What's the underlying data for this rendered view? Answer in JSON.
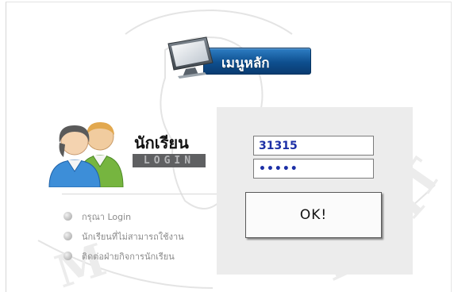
{
  "menu": {
    "label": "เมนูหลัก"
  },
  "login_card": {
    "title": "นักเรียน",
    "subtitle": "LOGIN",
    "links": [
      {
        "label": "กรุณา Login"
      },
      {
        "label": "นักเรียนที่ไม่สามารถใช้งาน"
      },
      {
        "label": "ติดต่อฝ่ายกิจการนักเรียน"
      }
    ]
  },
  "form": {
    "username_value": "31315",
    "password_value": "•••••",
    "ok_label": "OK!"
  },
  "colors": {
    "menu_bar": "#0e4f8f",
    "field_text": "#1c2fa6",
    "panel_bg": "#ececec",
    "login_badge": "#5f6062"
  },
  "icons": [
    "computer-monitor-icon",
    "users-avatar-icon",
    "bullet-icon"
  ]
}
